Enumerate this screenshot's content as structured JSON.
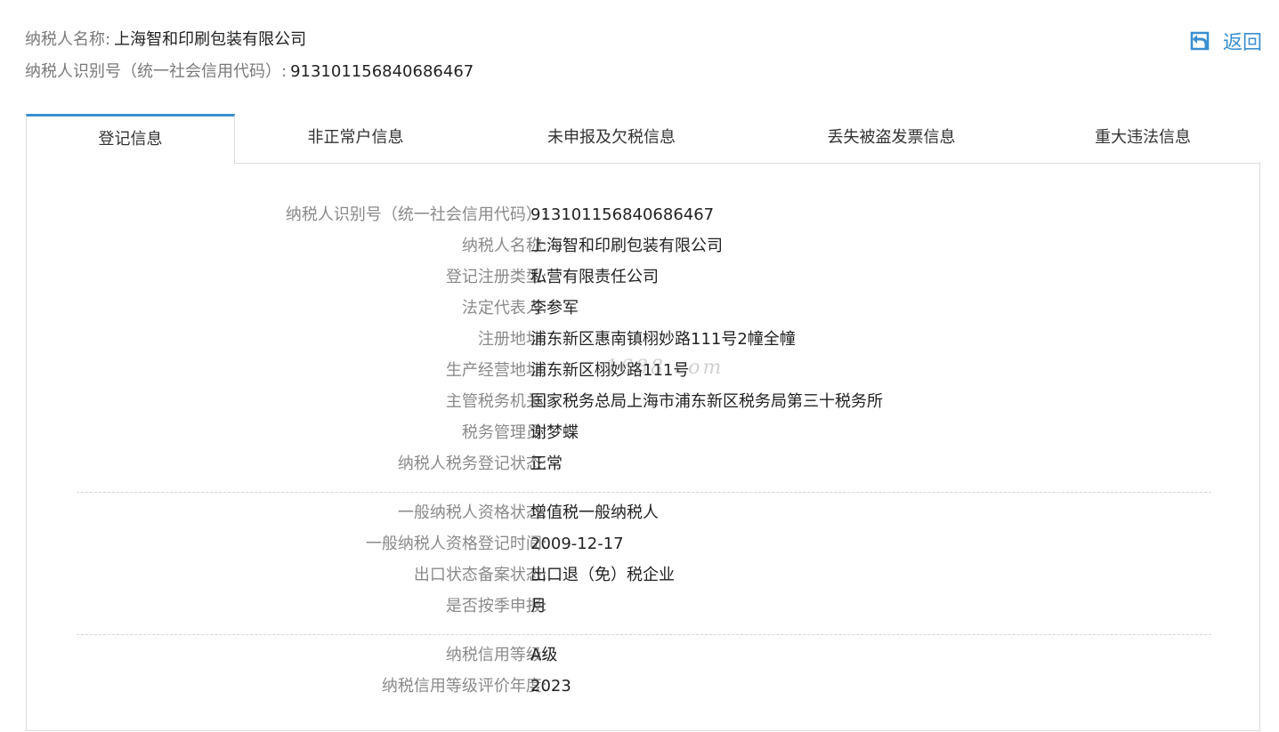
{
  "header": {
    "name_label": "纳税人名称:",
    "name_value": "上海智和印刷包装有限公司",
    "id_label": "纳税人识别号（统一社会信用代码）:",
    "id_value": "913101156840686467",
    "back_label": "返回",
    "back_icon": "back-arrow-icon"
  },
  "tabs": [
    {
      "label": "登记信息",
      "active": true
    },
    {
      "label": "非正常户信息",
      "active": false
    },
    {
      "label": "未申报及欠税信息",
      "active": false
    },
    {
      "label": "丢失被盗发票信息",
      "active": false
    },
    {
      "label": "重大违法信息",
      "active": false
    }
  ],
  "details": {
    "group1": [
      {
        "label": "纳税人识别号（统一社会信用代码）:",
        "value": "913101156840686467"
      },
      {
        "label": "纳税人名称:",
        "value": "上海智和印刷包装有限公司"
      },
      {
        "label": "登记注册类型:",
        "value": "私营有限责任公司"
      },
      {
        "label": "法定代表人:",
        "value": "李参军"
      },
      {
        "label": "注册地址:",
        "value": "浦东新区惠南镇栩妙路111号2幢全幢"
      },
      {
        "label": "生产经营地址:",
        "value": "浦东新区栩妙路111号"
      },
      {
        "label": "主管税务机关:",
        "value": "国家税务总局上海市浦东新区税务局第三十税务所"
      },
      {
        "label": "税务管理员:",
        "value": "谢梦蝶"
      },
      {
        "label": "纳税人税务登记状态:",
        "value": "正常"
      }
    ],
    "group2": [
      {
        "label": "一般纳税人资格状态:",
        "value": "增值税一般纳税人"
      },
      {
        "label": "一般纳税人资格登记时间:",
        "value": "2009-12-17"
      },
      {
        "label": "出口状态备案状态:",
        "value": "出口退（免）税企业"
      },
      {
        "label": "是否按季申报:",
        "value": "月"
      }
    ],
    "group3": [
      {
        "label": "纳税信用等级:",
        "value": "A级"
      },
      {
        "label": "纳税信用等级评价年度:",
        "value": "2023"
      }
    ]
  },
  "watermark": "1688.com",
  "colors": {
    "accent": "#3a8fd0",
    "label": "#8a8a8a",
    "value": "#222222",
    "border": "#dcdcdc"
  }
}
